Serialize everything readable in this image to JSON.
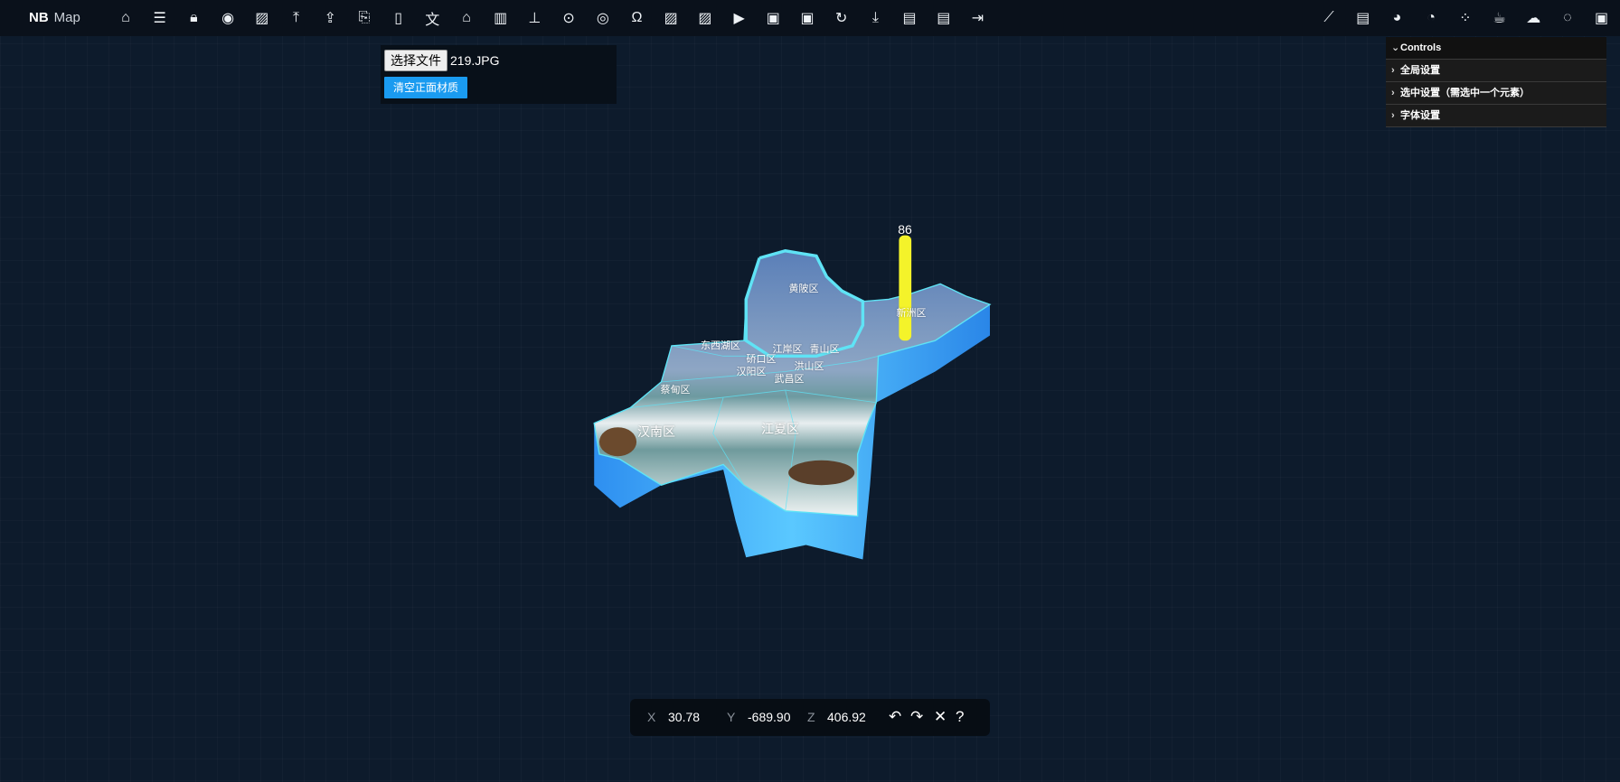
{
  "app": {
    "logo_bold": "NB",
    "logo_text": "Map"
  },
  "toolbar": {
    "left_icons": [
      "home-icon",
      "menu-indent-icon",
      "lock-icon",
      "eye-icon",
      "image-icon",
      "upload-icon",
      "export-icon",
      "file-upload-icon",
      "map-icon",
      "translate-icon",
      "building-icon",
      "bar-chart-icon",
      "pin-icon",
      "location-icon",
      "target-icon",
      "omega-icon",
      "picture-icon",
      "picture-alt-icon",
      "play-icon",
      "video-camera-icon",
      "video-icon",
      "replay-icon",
      "download-icon",
      "save-icon",
      "document-icon",
      "logout-icon"
    ],
    "right_icons": [
      "line-chart-icon",
      "report-icon",
      "globe-icon",
      "pie-chart-icon",
      "apps-icon",
      "coffee-icon",
      "wechat-icon",
      "chat-icon",
      "bilibili-icon"
    ]
  },
  "file_panel": {
    "choose_label": "选择文件",
    "file_name": "219.JPG",
    "clear_label": "清空正面材质"
  },
  "controls": {
    "title": "Controls",
    "items": [
      "全局设置",
      "选中设置（需选中一个元素）",
      "字体设置"
    ]
  },
  "coords": {
    "x_label": "X",
    "x": "30.78",
    "y_label": "Y",
    "y": "-689.90",
    "z_label": "Z",
    "z": "406.92",
    "undo": "↶",
    "redo": "↷",
    "close": "✕",
    "help": "?"
  },
  "map": {
    "bar_value": "86",
    "bar_color": "#f4f32a",
    "side_color": "#3aa8f5",
    "border_color": "#5fe3f5",
    "districts": [
      "黄陂区",
      "新洲区",
      "东西湖区",
      "江岸区",
      "青山区",
      "硚口区",
      "汉阳区",
      "洪山区",
      "武昌区",
      "蔡甸区",
      "汉南区",
      "江夏区"
    ]
  }
}
